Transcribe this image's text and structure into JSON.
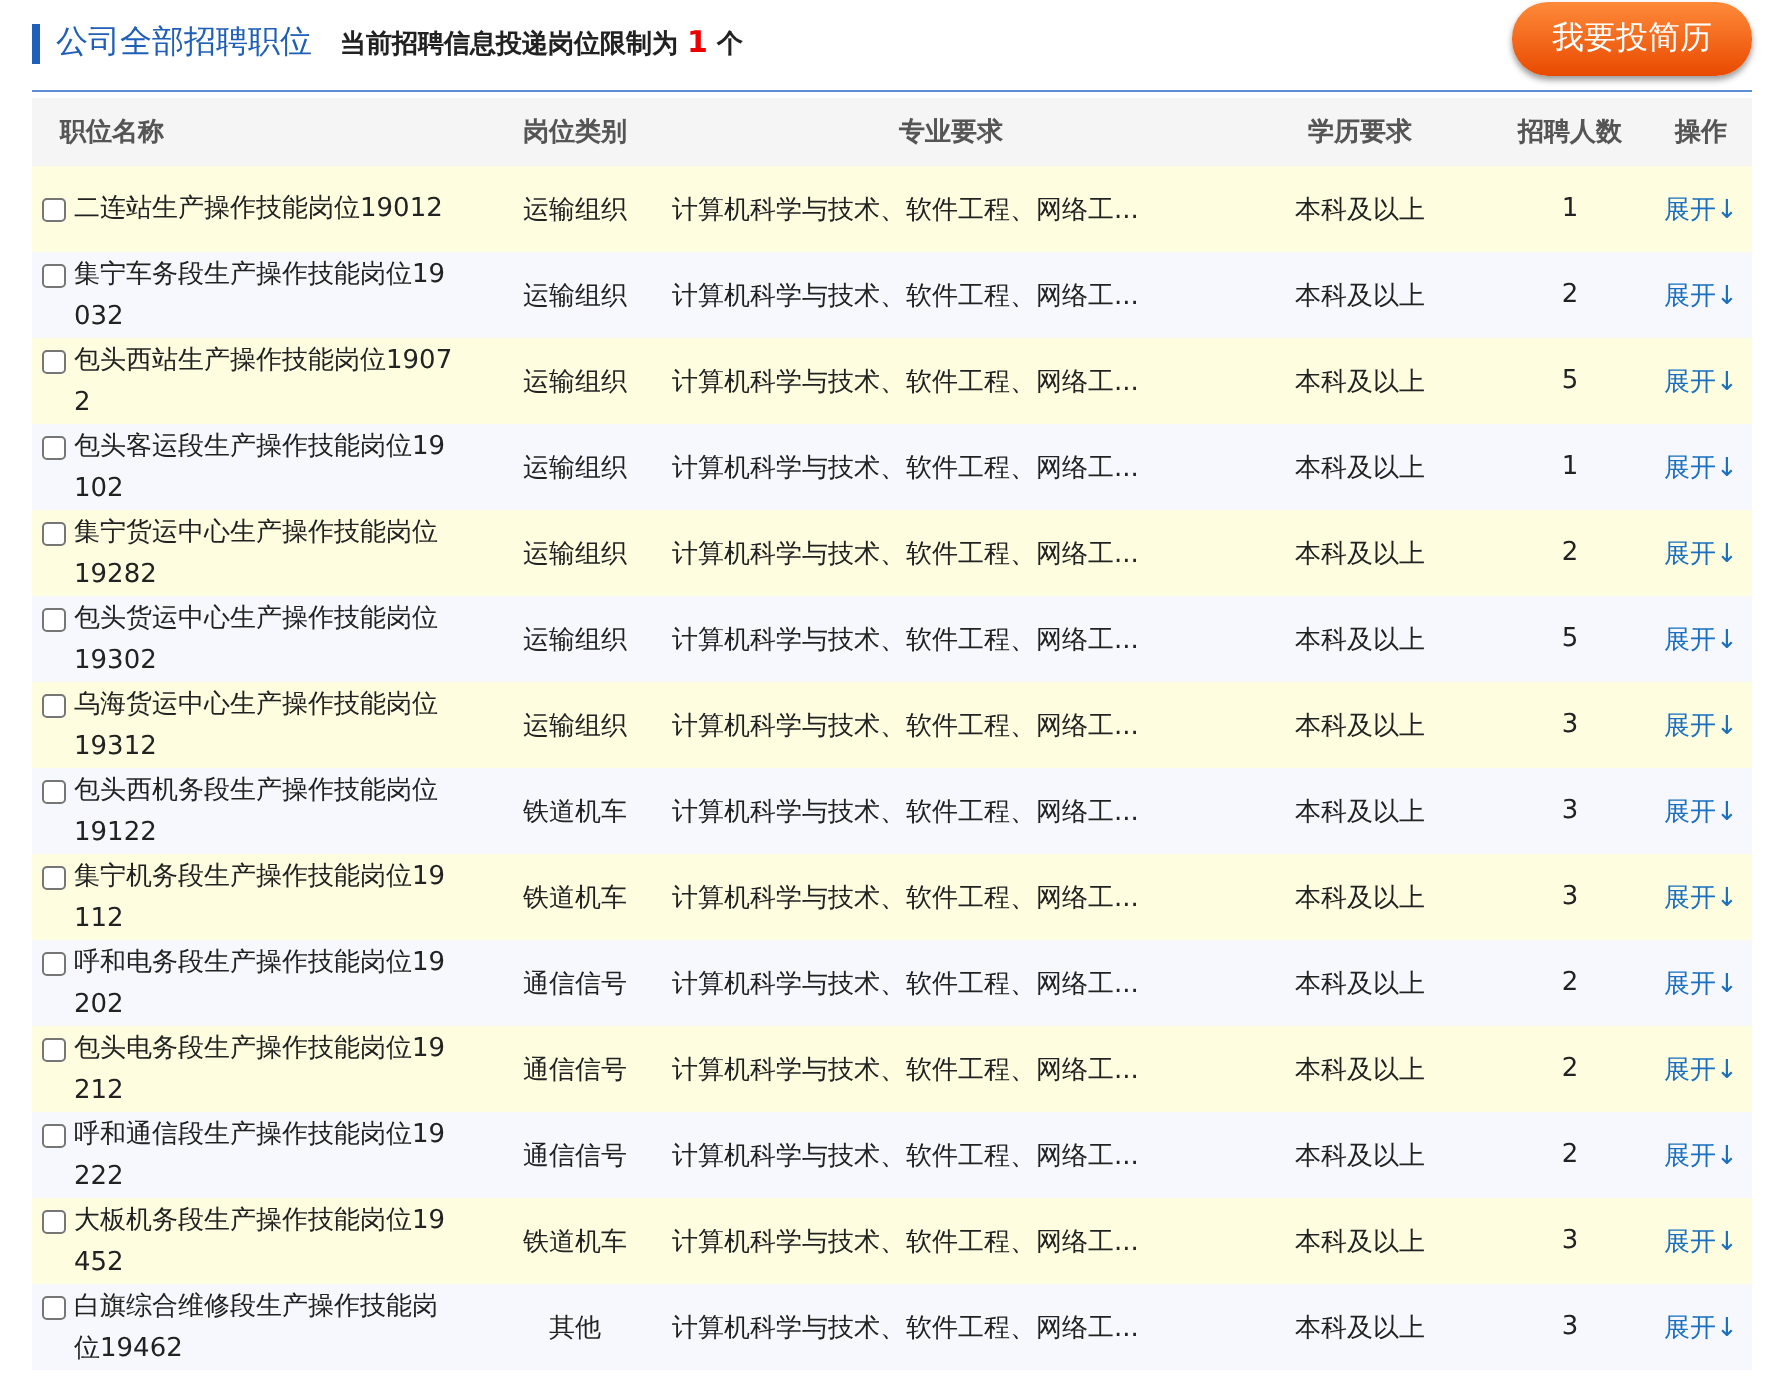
{
  "header": {
    "title": "公司全部招聘职位",
    "notice": {
      "prefix": "当前招聘信息投递岗位限制为",
      "count": "1",
      "suffix": "个"
    },
    "apply_button": "我要投简历"
  },
  "table": {
    "columns": [
      "职位名称",
      "岗位类别",
      "专业要求",
      "学历要求",
      "招聘人数",
      "操作"
    ],
    "rows": [
      {
        "checked": false,
        "name": "二连站生产操作技能岗位19012",
        "category": "运输组织",
        "major": "计算机科学与技术、软件工程、网络工...",
        "education": "本科及以上",
        "count": "1",
        "action": "展开↓"
      },
      {
        "checked": false,
        "name": "集宁车务段生产操作技能岗位19032",
        "category": "运输组织",
        "major": "计算机科学与技术、软件工程、网络工...",
        "education": "本科及以上",
        "count": "2",
        "action": "展开↓"
      },
      {
        "checked": false,
        "name": "包头西站生产操作技能岗位19072",
        "category": "运输组织",
        "major": "计算机科学与技术、软件工程、网络工...",
        "education": "本科及以上",
        "count": "5",
        "action": "展开↓"
      },
      {
        "checked": false,
        "name": "包头客运段生产操作技能岗位19102",
        "category": "运输组织",
        "major": "计算机科学与技术、软件工程、网络工...",
        "education": "本科及以上",
        "count": "1",
        "action": "展开↓"
      },
      {
        "checked": false,
        "name": "集宁货运中心生产操作技能岗位19282",
        "category": "运输组织",
        "major": "计算机科学与技术、软件工程、网络工...",
        "education": "本科及以上",
        "count": "2",
        "action": "展开↓"
      },
      {
        "checked": false,
        "name": "包头货运中心生产操作技能岗位19302",
        "category": "运输组织",
        "major": "计算机科学与技术、软件工程、网络工...",
        "education": "本科及以上",
        "count": "5",
        "action": "展开↓"
      },
      {
        "checked": false,
        "name": "乌海货运中心生产操作技能岗位19312",
        "category": "运输组织",
        "major": "计算机科学与技术、软件工程、网络工...",
        "education": "本科及以上",
        "count": "3",
        "action": "展开↓"
      },
      {
        "checked": false,
        "name": "包头西机务段生产操作技能岗位19122",
        "category": "铁道机车",
        "major": "计算机科学与技术、软件工程、网络工...",
        "education": "本科及以上",
        "count": "3",
        "action": "展开↓"
      },
      {
        "checked": false,
        "name": "集宁机务段生产操作技能岗位19112",
        "category": "铁道机车",
        "major": "计算机科学与技术、软件工程、网络工...",
        "education": "本科及以上",
        "count": "3",
        "action": "展开↓"
      },
      {
        "checked": false,
        "name": "呼和电务段生产操作技能岗位19202",
        "category": "通信信号",
        "major": "计算机科学与技术、软件工程、网络工...",
        "education": "本科及以上",
        "count": "2",
        "action": "展开↓"
      },
      {
        "checked": false,
        "name": "包头电务段生产操作技能岗位19212",
        "category": "通信信号",
        "major": "计算机科学与技术、软件工程、网络工...",
        "education": "本科及以上",
        "count": "2",
        "action": "展开↓"
      },
      {
        "checked": false,
        "name": "呼和通信段生产操作技能岗位19222",
        "category": "通信信号",
        "major": "计算机科学与技术、软件工程、网络工...",
        "education": "本科及以上",
        "count": "2",
        "action": "展开↓"
      },
      {
        "checked": false,
        "name": "大板机务段生产操作技能岗位19452",
        "category": "铁道机车",
        "major": "计算机科学与技术、软件工程、网络工...",
        "education": "本科及以上",
        "count": "3",
        "action": "展开↓"
      },
      {
        "checked": false,
        "name": "白旗综合维修段生产操作技能岗位19462",
        "category": "其他",
        "major": "计算机科学与技术、软件工程、网络工...",
        "education": "本科及以上",
        "count": "3",
        "action": "展开↓"
      }
    ]
  }
}
